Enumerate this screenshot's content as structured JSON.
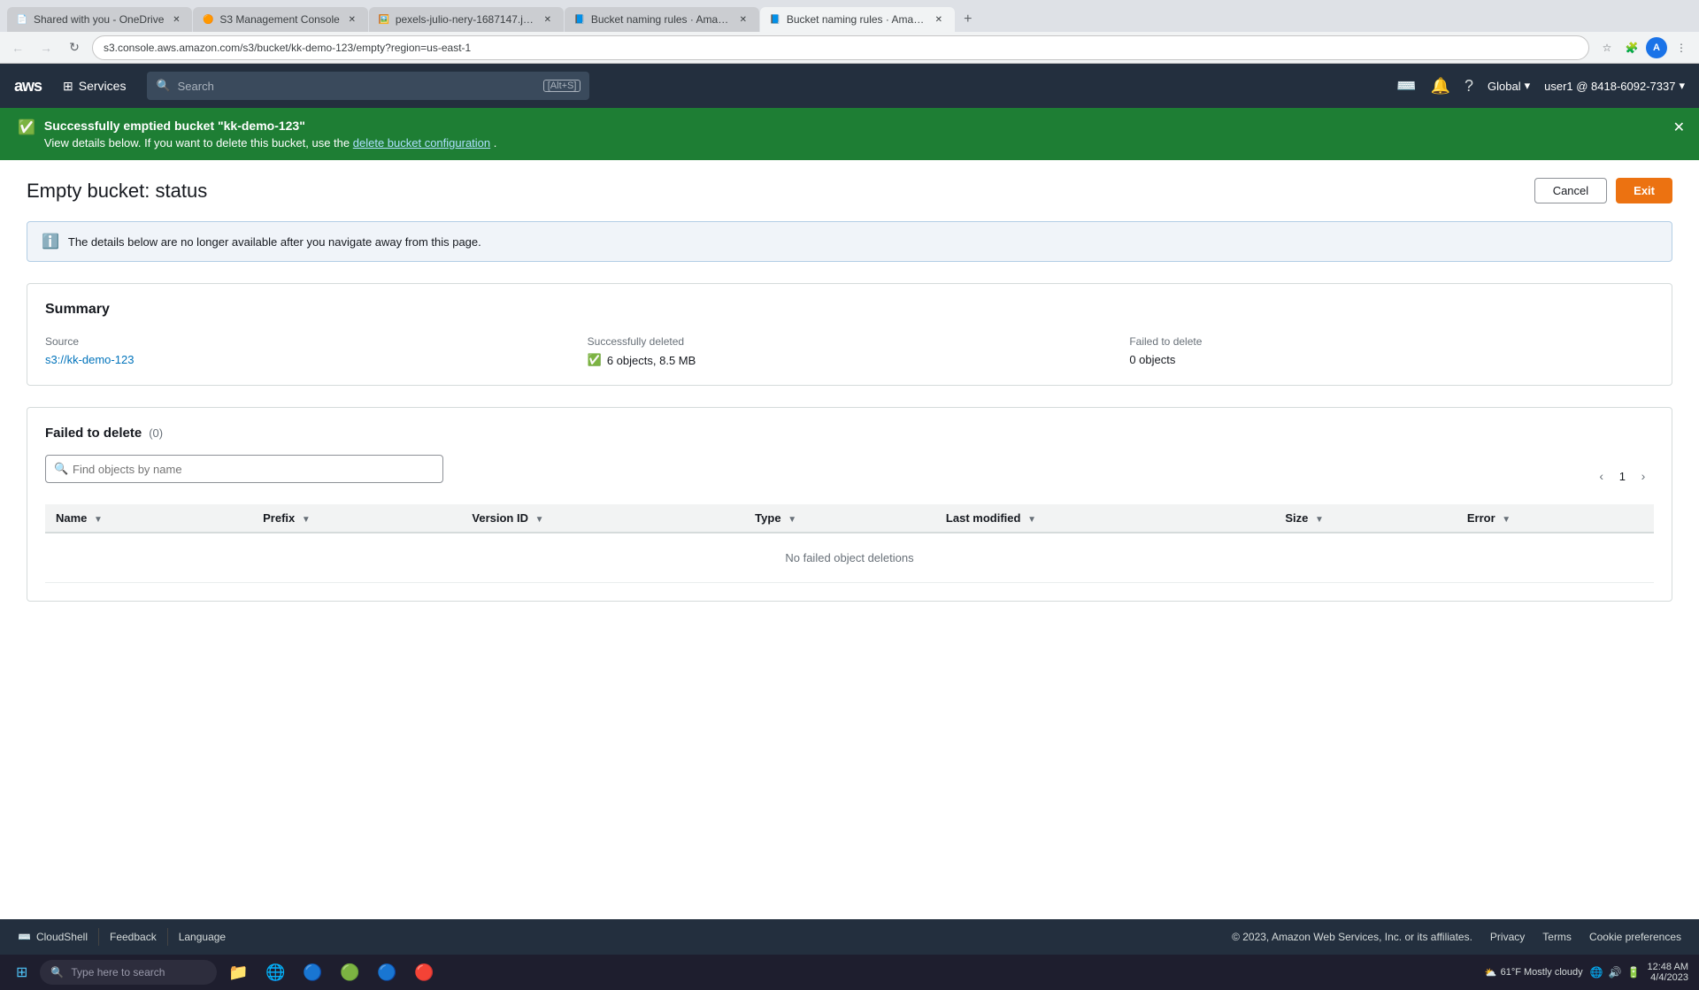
{
  "browser": {
    "tabs": [
      {
        "id": "tab1",
        "title": "Shared with you - OneDrive",
        "active": false,
        "favicon": "📄"
      },
      {
        "id": "tab2",
        "title": "S3 Management Console",
        "active": false,
        "favicon": "🟠"
      },
      {
        "id": "tab3",
        "title": "pexels-julio-nery-1687147.jpg |...",
        "active": false,
        "favicon": "🖼️"
      },
      {
        "id": "tab4",
        "title": "Bucket naming rules · Amazon S...",
        "active": false,
        "favicon": "📘"
      },
      {
        "id": "tab5",
        "title": "Bucket naming rules · Amazon S...",
        "active": true,
        "favicon": "📘"
      }
    ],
    "address": "s3.console.aws.amazon.com/s3/bucket/kk-demo-123/empty?region=us-east-1"
  },
  "header": {
    "services_label": "Services",
    "search_placeholder": "Search",
    "search_shortcut": "[Alt+S]",
    "region_label": "Global",
    "user_label": "user1 @ 8418-6092-7337"
  },
  "banner": {
    "title": "Successfully emptied bucket \"kk-demo-123\"",
    "subtitle": "View details below. If you want to delete this bucket, use the",
    "link_text": "delete bucket configuration",
    "link_suffix": "."
  },
  "page": {
    "title": "Empty bucket: status",
    "cancel_label": "Cancel",
    "exit_label": "Exit"
  },
  "info_banner": {
    "text": "The details below are no longer available after you navigate away from this page."
  },
  "summary": {
    "title": "Summary",
    "source_label": "Source",
    "source_value": "s3://kk-demo-123",
    "successfully_deleted_label": "Successfully deleted",
    "successfully_deleted_value": "6 objects, 8.5 MB",
    "failed_to_delete_label": "Failed to delete",
    "failed_to_delete_value": "0 objects"
  },
  "failed_section": {
    "title": "Failed to delete",
    "count": "(0)",
    "search_placeholder": "Find objects by name",
    "pagination_current": "1",
    "table": {
      "columns": [
        "Name",
        "Prefix",
        "Version ID",
        "Type",
        "Last modified",
        "Size",
        "Error"
      ],
      "empty_message": "No failed object deletions"
    }
  },
  "footer": {
    "cloudshell_label": "CloudShell",
    "feedback_label": "Feedback",
    "language_label": "Language",
    "copyright": "© 2023, Amazon Web Services, Inc. or its affiliates.",
    "privacy_label": "Privacy",
    "terms_label": "Terms",
    "cookie_label": "Cookie preferences"
  },
  "taskbar": {
    "search_placeholder": "Type here to search",
    "time": "12:48 AM",
    "date": "4/4/2023",
    "weather": "61°F  Mostly cloudy",
    "weather_icon": "⛅"
  }
}
